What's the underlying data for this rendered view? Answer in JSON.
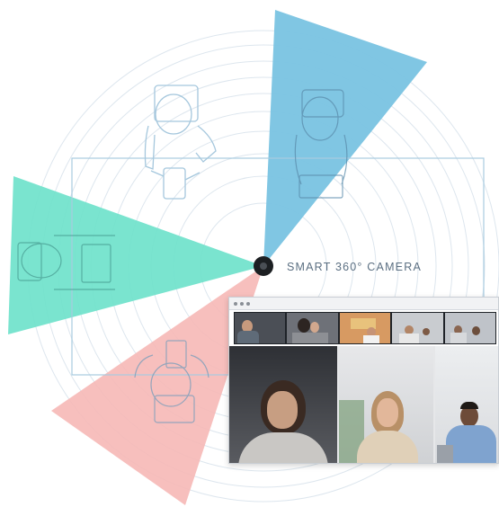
{
  "camera": {
    "label": "SMART 360° CAMERA",
    "icon": "camera-icon"
  },
  "coverage_sectors": [
    {
      "name": "teal",
      "color": "#5fe0c6"
    },
    {
      "name": "blue",
      "color": "#6cbcde"
    },
    {
      "name": "pink",
      "color": "#f4a9a8"
    }
  ],
  "colors": {
    "line_art": "#9ec3dc",
    "rings": "#dde6ee"
  },
  "video_window": {
    "window_dots": 3,
    "filmstrip_thumbnails": 5,
    "tiles": 3
  }
}
